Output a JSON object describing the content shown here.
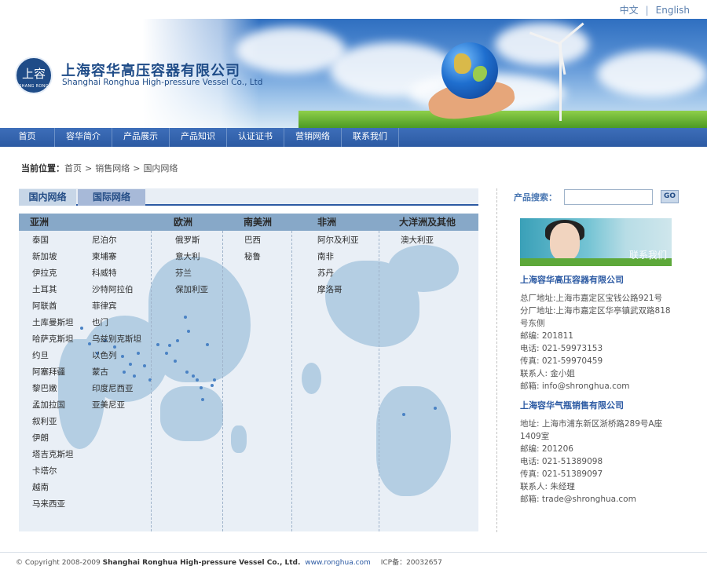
{
  "lang": {
    "chinese": "中文",
    "english": "English"
  },
  "header": {
    "company_cn": "上海容华高压容器有限公司",
    "company_en": "Shanghai Ronghua High-pressure Vessel Co., Ltd",
    "logo_cn": "上容",
    "logo_en": "SHANG RONG"
  },
  "nav": [
    "首页",
    "容华简介",
    "产品展示",
    "产品知识",
    "认证证书",
    "营销网络",
    "联系我们"
  ],
  "breadcrumb": {
    "label": "当前位置：",
    "items": [
      "首页",
      "销售网络",
      "国内网络"
    ],
    "sep": ">"
  },
  "tabs": {
    "domestic": "国内网络",
    "international": "国际网络"
  },
  "regions": [
    "亚洲",
    "欧洲",
    "南美洲",
    "非洲",
    "大洋洲及其他"
  ],
  "countries": {
    "asia_col1": [
      "泰国",
      "新加坡",
      "伊拉克",
      "土耳其",
      "阿联酋",
      "土库曼斯坦",
      "哈萨克斯坦",
      "约旦",
      "阿塞拜疆",
      "黎巴嫩",
      "孟加拉国",
      "叙利亚",
      "伊朗",
      "塔吉克斯坦",
      "卡塔尔",
      "越南",
      "马来西亚"
    ],
    "asia_col2": [
      "尼泊尔",
      "柬埔寨",
      "科威特",
      "沙特阿拉伯",
      "菲律宾",
      "也门",
      "乌兹别克斯坦",
      "以色列",
      "蒙古",
      "印度尼西亚",
      "亚美尼亚"
    ],
    "europe": [
      "俄罗斯",
      "意大利",
      "芬兰",
      "保加利亚"
    ],
    "south_america": [
      "巴西",
      "秘鲁"
    ],
    "africa": [
      "阿尔及利亚",
      "南非",
      "苏丹",
      "摩洛哥"
    ],
    "oceania": [
      "澳大利亚"
    ]
  },
  "sidebar": {
    "search_label": "产品搜索：",
    "search_placeholder": "",
    "go_label": "GO",
    "contact_banner": "联系我们",
    "company1": {
      "name": "上海容华高压容器有限公司",
      "lines": [
        "总厂地址:上海市嘉定区宝钱公路921号",
        "分厂地址:上海市嘉定区华亭镇武双路818号东侧",
        "邮编: 201811",
        "电话: 021-59973153",
        "传真: 021-59970459",
        "联系人: 金小姐",
        "邮箱: info@shronghua.com"
      ]
    },
    "company2": {
      "name": "上海容华气瓶销售有限公司",
      "lines": [
        "地址: 上海市浦东新区浙桥路289号A座1409室",
        "邮编: 201206",
        "电话: 021-51389098",
        "传真: 021-51389097",
        "联系人: 朱经理",
        "邮箱: trade@shronghua.com"
      ]
    }
  },
  "footer": {
    "copyright": "© Copyright 2008-2009",
    "company": "Shanghai Ronghua High-pressure Vessel Co., Ltd.",
    "url": "www.ronghua.com",
    "icp": "ICP备：20032657"
  }
}
